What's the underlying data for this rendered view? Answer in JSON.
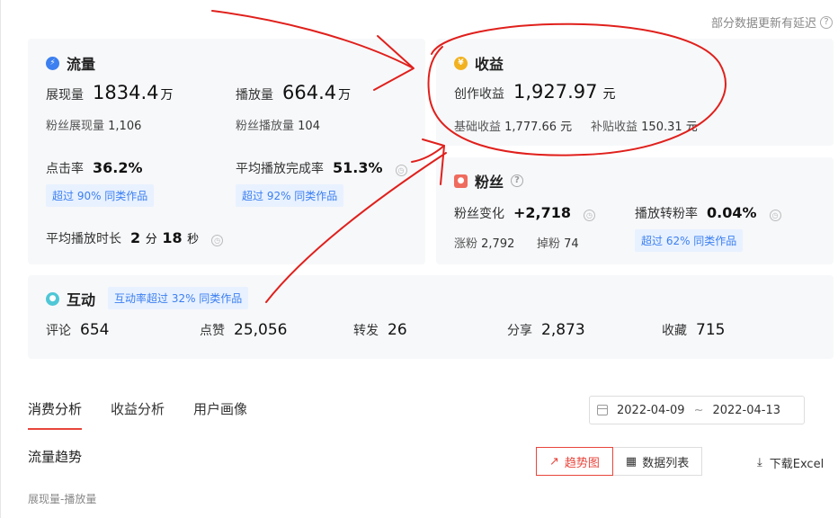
{
  "notice": {
    "text": "部分数据更新有延迟",
    "help": "?"
  },
  "traffic": {
    "title": "流量",
    "exposure": {
      "label": "展现量",
      "value": "1834.4",
      "unit": "万"
    },
    "plays": {
      "label": "播放量",
      "value": "664.4",
      "unit": "万"
    },
    "fan_exposure": {
      "label": "粉丝展现量",
      "value": "1,106"
    },
    "fan_plays": {
      "label": "粉丝播放量",
      "value": "104"
    },
    "ctr": {
      "label": "点击率",
      "value": "36.2%",
      "badge": "超过 90% 同类作品"
    },
    "completion": {
      "label": "平均播放完成率",
      "value": "51.3%",
      "badge": "超过 92% 同类作品"
    },
    "duration": {
      "label": "平均播放时长",
      "min": "2",
      "min_unit": "分",
      "sec": "18",
      "sec_unit": "秒"
    }
  },
  "revenue": {
    "title": "收益",
    "creation": {
      "label": "创作收益",
      "value": "1,927.97",
      "unit": "元"
    },
    "base": {
      "label": "基础收益",
      "value": "1,777.66 元"
    },
    "subsidy": {
      "label": "补贴收益",
      "value": "150.31 元"
    }
  },
  "fans": {
    "title": "粉丝",
    "change": {
      "label": "粉丝变化",
      "value": "+2,718"
    },
    "gain": {
      "label": "涨粉",
      "value": "2,792"
    },
    "loss": {
      "label": "掉粉",
      "value": "74"
    },
    "conversion": {
      "label": "播放转粉率",
      "value": "0.04%",
      "badge": "超过 62% 同类作品"
    }
  },
  "interaction": {
    "title": "互动",
    "badge": "互动率超过 32% 同类作品",
    "items": [
      {
        "label": "评论",
        "value": "654"
      },
      {
        "label": "点赞",
        "value": "25,056"
      },
      {
        "label": "转发",
        "value": "26"
      },
      {
        "label": "分享",
        "value": "2,873"
      },
      {
        "label": "收藏",
        "value": "715"
      }
    ]
  },
  "tabs": [
    "消费分析",
    "收益分析",
    "用户画像"
  ],
  "date_range": {
    "start": "2022-04-09",
    "sep": "~",
    "end": "2022-04-13"
  },
  "trend": {
    "title": "流量趋势",
    "chart_btn": "趋势图",
    "table_btn": "数据列表",
    "download": "下载Excel",
    "caption": "展现量-播放量"
  },
  "colors": {
    "accent": "#e8453c",
    "badge_text": "#3b7ff0",
    "annotation": "#e0201c"
  }
}
